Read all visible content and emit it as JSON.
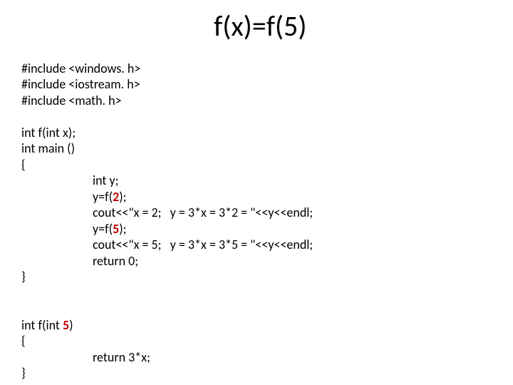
{
  "title": "f(x)=f(5)",
  "code": {
    "inc1": "#include <windows. h>",
    "inc2": "#include <iostream. h>",
    "inc3": "#include <math. h>",
    "decl": "int f(int x);",
    "main_sig": "int main ()",
    "brace_open": "{",
    "l_inty": "int y;",
    "l_yf2_a": "y=f(",
    "l_yf2_b": "2",
    "l_yf2_c": ");",
    "l_cout2": "cout<<\"x = 2;   y = 3*x = 3*2 = \"<<y<<endl;",
    "l_yf5_a": "y=f(",
    "l_yf5_b": "5",
    "l_yf5_c": ");",
    "l_cout5": "cout<<\"x = 5;   y = 3*x = 3*5 = \"<<y<<endl;",
    "l_ret0": "return 0;",
    "brace_close": "}",
    "func_sig_a": "int f(int ",
    "func_sig_b": "5",
    "func_sig_c": ")",
    "l_ret3x": "return 3*x;"
  }
}
